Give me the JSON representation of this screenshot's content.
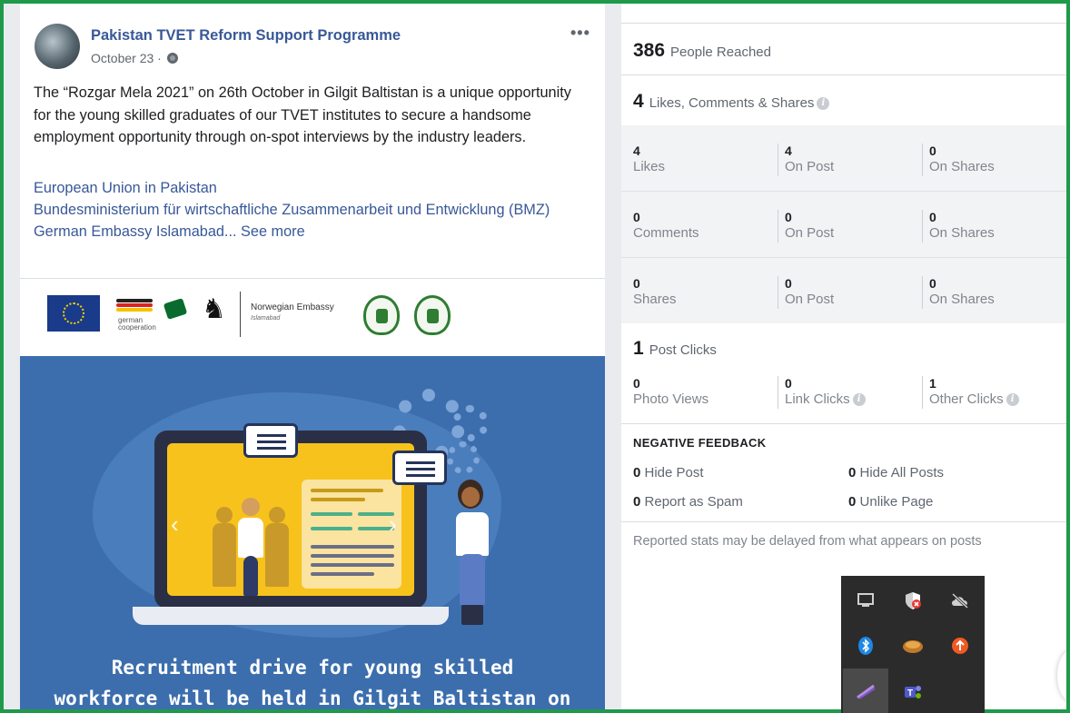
{
  "post": {
    "page_name": "Pakistan TVET Reform Support Programme",
    "date": "October 23 ·",
    "more_label": "•••",
    "text": "The “Rozgar Mela 2021” on 26th October in Gilgit Baltistan is a unique opportunity for the young skilled graduates of our TVET institutes to secure a handsome employment opportunity through on-spot interviews by the industry leaders.",
    "tags": [
      "European Union in Pakistan",
      "Bundesministerium für wirtschaftliche Zusammenarbeit und Entwicklung (BMZ)",
      "German Embassy Islamabad..."
    ],
    "see_more": "See more",
    "logos": {
      "german_line1": "german",
      "german_line2": "cooperation",
      "norway_name": "Norwegian Embassy",
      "norway_city": "Islamabad"
    },
    "graphic_caption_line1": "Recruitment drive for young skilled",
    "graphic_caption_line2": "workforce will be held in Gilgit Baltistan on"
  },
  "insights": {
    "reach": {
      "value": "386",
      "label": "People Reached"
    },
    "engagement": {
      "value": "4",
      "label": "Likes, Comments & Shares"
    },
    "likes": {
      "total": "4",
      "total_label": "Likes",
      "on_post": "4",
      "on_post_label": "On Post",
      "on_shares": "0",
      "on_shares_label": "On Shares"
    },
    "comments": {
      "total": "0",
      "total_label": "Comments",
      "on_post": "0",
      "on_post_label": "On Post",
      "on_shares": "0",
      "on_shares_label": "On Shares"
    },
    "shares": {
      "total": "0",
      "total_label": "Shares",
      "on_post": "0",
      "on_post_label": "On Post",
      "on_shares": "0",
      "on_shares_label": "On Shares"
    },
    "clicks": {
      "value": "1",
      "label": "Post Clicks",
      "photo_views": "0",
      "photo_views_label": "Photo Views",
      "link_clicks": "0",
      "link_clicks_label": "Link Clicks",
      "other_clicks": "1",
      "other_clicks_label": "Other Clicks"
    },
    "negative_title": "NEGATIVE FEEDBACK",
    "negative": {
      "hide_post": "0",
      "hide_post_label": "Hide Post",
      "hide_all": "0",
      "hide_all_label": "Hide All Posts",
      "spam": "0",
      "spam_label": "Report as Spam",
      "unlike": "0",
      "unlike_label": "Unlike Page"
    },
    "footnote": "Reported stats may be delayed from what appears on posts",
    "info_glyph": "i"
  },
  "tray": {
    "icons": [
      "display-icon",
      "security-shield-icon",
      "cloud-offline-icon",
      "bluetooth-icon",
      "app-icon",
      "update-arrow-icon",
      "pen-icon",
      "teams-icon"
    ],
    "colors": {
      "bg": "#2b2b2b",
      "selected": "#4a4a4a",
      "bluetooth": "#1e88e5",
      "update": "#f05a22"
    }
  },
  "colors": {
    "frame": "#1f9a4a",
    "link": "#385898",
    "graphic_bg": "#3c6ead",
    "laptop_screen": "#f8c21d"
  }
}
